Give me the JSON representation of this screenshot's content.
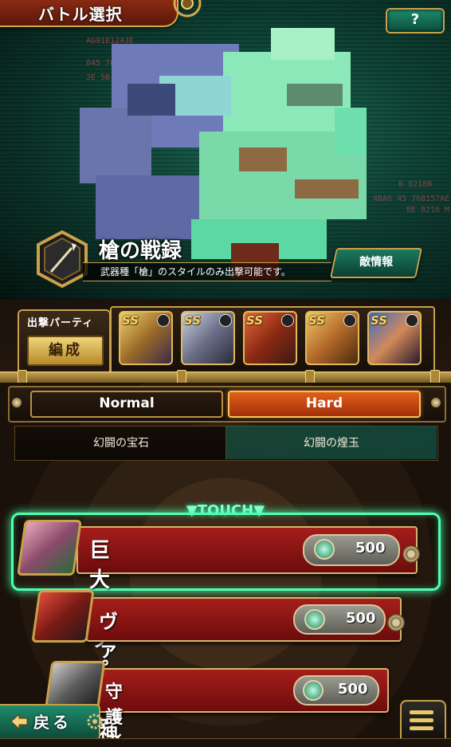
{
  "header": {
    "title": "バトル選択",
    "help_label": "?"
  },
  "quest": {
    "title": "槍の戦録",
    "description": "武器種「槍」のスタイルのみ出撃可能です。",
    "enemy_info_label": "敵情報"
  },
  "banner_text": {
    "hex_left_1": "AG91E1243E",
    "hex_left_2": "845 768 1874",
    "hex_left_3": "2E 5B 845",
    "hex_right_1": "B 8216N",
    "hex_right_2": "4BA6 45 76B157AE",
    "hex_right_3": "BE 8216 M"
  },
  "party": {
    "label": "出撃パーティ",
    "edit_label": "編成",
    "members": [
      {
        "rank": "SS",
        "name": "member-1"
      },
      {
        "rank": "SS",
        "name": "member-2"
      },
      {
        "rank": "SS",
        "name": "member-3"
      },
      {
        "rank": "SS",
        "name": "member-4"
      },
      {
        "rank": "SS",
        "name": "member-5"
      }
    ]
  },
  "difficulty": {
    "normal_label": "Normal",
    "hard_label": "Hard",
    "selected": "Hard"
  },
  "tabs": [
    {
      "label": "幻闘の宝石"
    },
    {
      "label": "幻闘の煌玉"
    }
  ],
  "touch_label": "▼TOUCH▼",
  "battles": [
    {
      "name": "巨大コッペリア",
      "cost": "500",
      "highlighted": true
    },
    {
      "name": "ヴァッハ神",
      "cost": "500",
      "highlighted": false
    },
    {
      "name": "守護者",
      "cost": "500",
      "highlighted": false
    }
  ],
  "footer": {
    "back_label": "戻る",
    "menu_icon": "hamburger-menu-icon"
  },
  "colors": {
    "accent_gold": "#c9a14a",
    "hard_orange": "#e0601a",
    "battle_red": "#a51e1a",
    "touch_glow": "#4fffb3",
    "banner_teal": "#1d6b57"
  }
}
